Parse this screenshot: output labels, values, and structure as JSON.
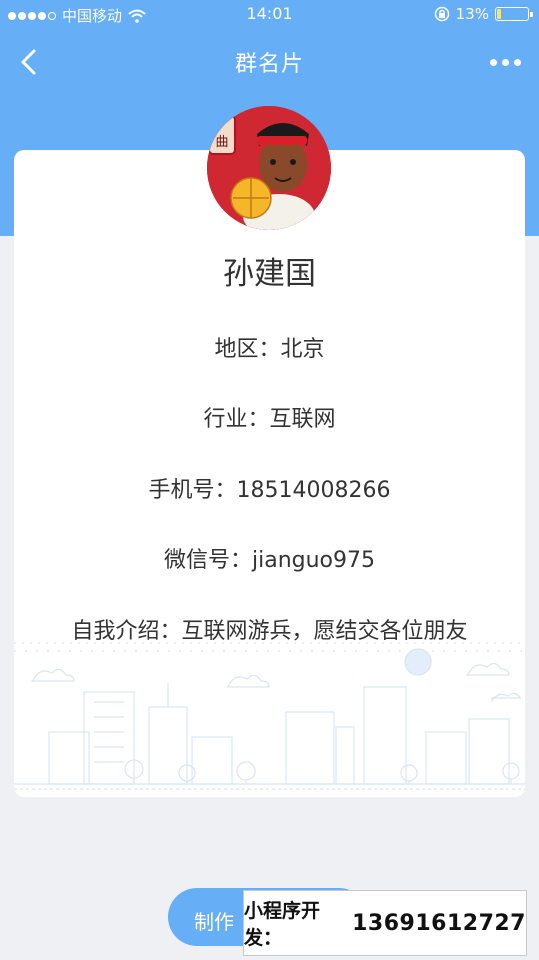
{
  "status_bar": {
    "carrier": "中国移动",
    "time": "14:01",
    "battery_percent": "13%",
    "battery_level": 0.13
  },
  "nav": {
    "title": "群名片",
    "back_icon": "chevron-left-icon",
    "more_icon": "more-dots-icon"
  },
  "profile": {
    "name": "孙建国",
    "region": "地区：北京",
    "industry": "行业：互联网",
    "phone": "手机号：18514008266",
    "wechat": "微信号：jianguo975",
    "intro": "自我介绍：互联网游兵，愿结交各位朋友"
  },
  "avatar": {
    "badge_text": "曲"
  },
  "actions": {
    "make_card_label": "制作"
  },
  "promo": {
    "label": "小程序开发：",
    "number": "13691612727"
  },
  "colors": {
    "accent": "#66aef5",
    "background": "#eef0f4",
    "card": "#ffffff",
    "text": "#333333",
    "battery": "#ffe36a"
  }
}
